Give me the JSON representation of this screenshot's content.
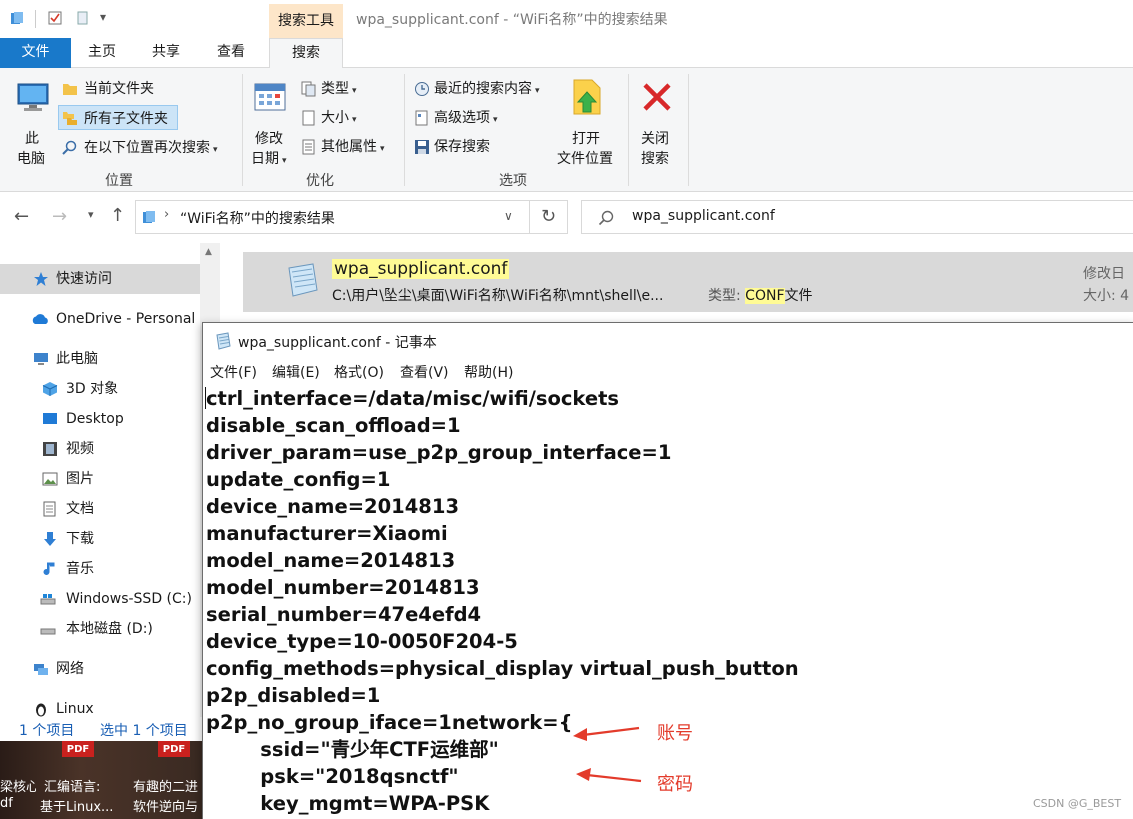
{
  "explorer": {
    "title": "wpa_supplicant.conf - “WiFi名称”中的搜索结果",
    "context_tab": "搜索工具",
    "tabs": [
      "文件",
      "主页",
      "共享",
      "查看",
      "搜索"
    ],
    "ribbon": {
      "this_pc": [
        "此",
        "电脑"
      ],
      "location": {
        "current_folder": "当前文件夹",
        "all_subfolders": "所有子文件夹",
        "search_again_in": "在以下位置再次搜索",
        "label": "位置"
      },
      "refine": {
        "date_modified": [
          "修改",
          "日期"
        ],
        "kind": "类型",
        "size": "大小",
        "other_properties": "其他属性",
        "label": "优化"
      },
      "options": {
        "recent_searches": "最近的搜索内容",
        "advanced_options": "高级选项",
        "save_search": "保存搜索",
        "label": "选项"
      },
      "open_file_location": [
        "打开",
        "文件位置"
      ],
      "close_search": [
        "关闭",
        "搜索"
      ]
    },
    "address": "“WiFi名称”中的搜索结果",
    "search_query": "wpa_supplicant.conf",
    "nav": {
      "quick_access": "快速访问",
      "onedrive": "OneDrive - Personal",
      "this_pc": "此电脑",
      "objects_3d": "3D 对象",
      "desktop": "Desktop",
      "videos": "视频",
      "pictures": "图片",
      "documents": "文档",
      "downloads": "下载",
      "music": "音乐",
      "windows_ssd": "Windows-SSD (C:)",
      "local_disk": "本地磁盘 (D:)",
      "network": "网络",
      "linux": "Linux"
    },
    "result": {
      "name": "wpa_supplicant.conf",
      "path": "C:\\用户\\坠尘\\桌面\\WiFi名称\\WiFi名称\\mnt\\shell\\e...",
      "type_label": "类型:",
      "type_value": "CONF",
      "type_suffix": "文件",
      "modified_label": "修改日",
      "size_label": "大小: 4"
    },
    "status": {
      "items": "1 个项目",
      "selected": "选中 1 个项目"
    }
  },
  "desktop": {
    "row1": [
      "梁核心",
      "汇编语言:",
      "有趣的二进"
    ],
    "row2": [
      "df",
      "基于Linux...",
      "软件逆向与"
    ],
    "pdf_badge": "PDF"
  },
  "notepad": {
    "title": "wpa_supplicant.conf - 记事本",
    "menu": [
      "文件(F)",
      "编辑(E)",
      "格式(O)",
      "查看(V)",
      "帮助(H)"
    ],
    "lines": [
      "ctrl_interface=/data/misc/wifi/sockets",
      "disable_scan_offload=1",
      "driver_param=use_p2p_group_interface=1",
      "update_config=1",
      "device_name=2014813",
      "manufacturer=Xiaomi",
      "model_name=2014813",
      "model_number=2014813",
      "serial_number=47e4efd4",
      "device_type=10-0050F204-5",
      "config_methods=physical_display virtual_push_button",
      "p2p_disabled=1",
      "p2p_no_group_iface=1network={",
      "        ssid=\"青少年CTF运维部\"",
      "        psk=\"2018qsnctf\"",
      "        key_mgmt=WPA-PSK"
    ]
  },
  "annotations": {
    "account": "账号",
    "password": "密码",
    "arrow_color": "#e33b2b"
  },
  "watermark": "CSDN @G_BEST",
  "colors": {
    "accent": "#1979ca",
    "highlight": "#fffb95",
    "context_tab_bg": "#fde6c9"
  }
}
